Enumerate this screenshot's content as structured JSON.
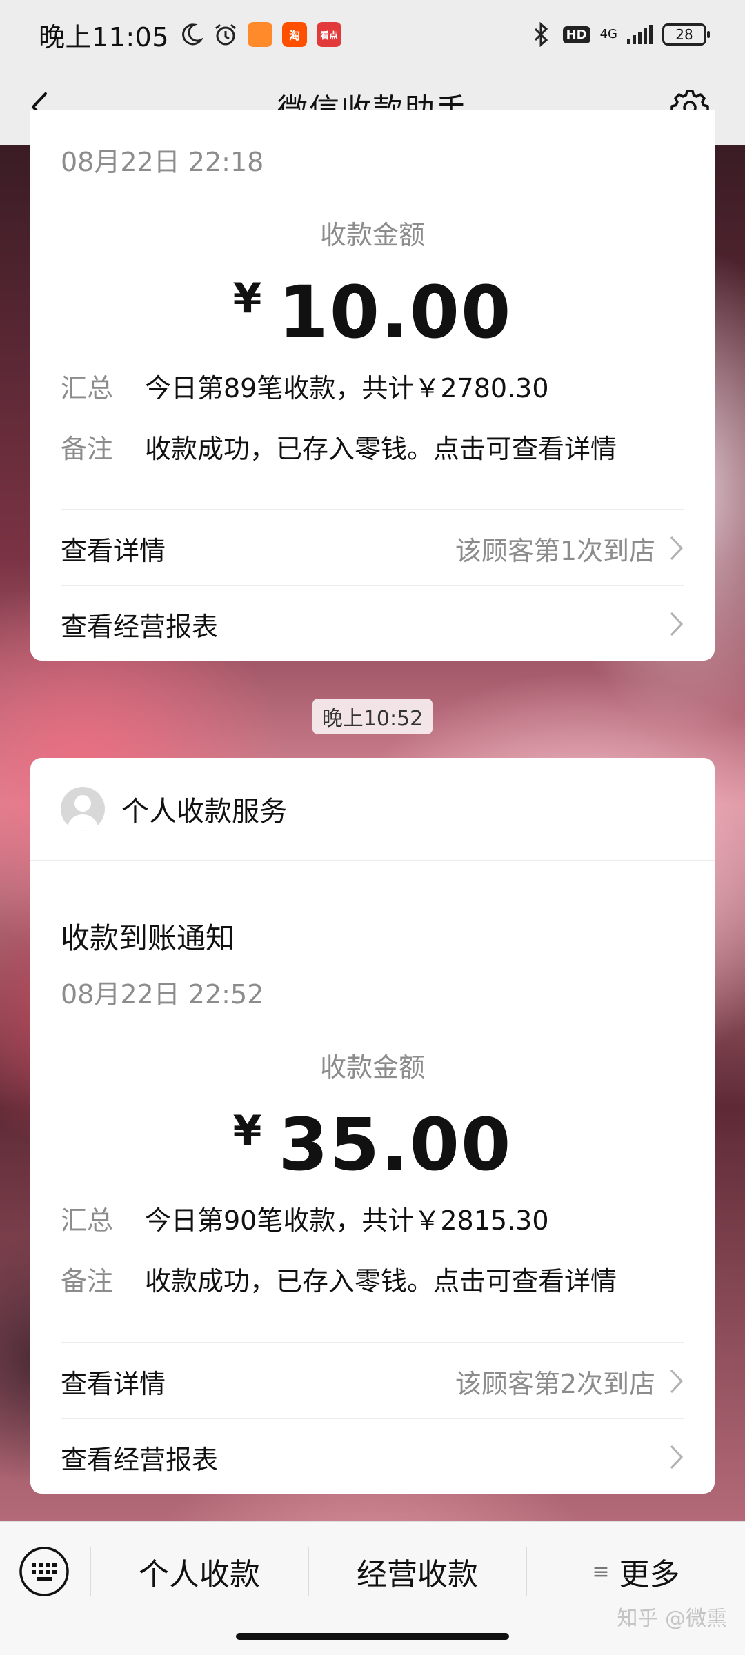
{
  "status_bar": {
    "time": "晚上11:05",
    "app_badges": [
      {
        "text": "",
        "color": "#ff8a2a"
      },
      {
        "text": "淘",
        "color": "#ff5000"
      },
      {
        "text": "看点",
        "color": "#e23a3a"
      }
    ],
    "network": "4G",
    "battery": "28"
  },
  "header": {
    "title": "微信收款助手"
  },
  "messages": [
    {
      "date": "08月22日 22:18",
      "amount_label": "收款金额",
      "currency": "¥",
      "amount": "10.00",
      "summary_key": "汇总",
      "summary_value": "今日第89笔收款，共计￥2780.30",
      "remark_key": "备注",
      "remark_value": "收款成功，已存入零钱。点击可查看详情",
      "details_label": "查看详情",
      "details_note": "该顾客第1次到店",
      "report_label": "查看经营报表"
    },
    {
      "time_chip": "晚上10:52",
      "service_name": "个人收款服务",
      "notice_title": "收款到账通知",
      "date": "08月22日 22:52",
      "amount_label": "收款金额",
      "currency": "¥",
      "amount": "35.00",
      "summary_key": "汇总",
      "summary_value": "今日第90笔收款，共计￥2815.30",
      "remark_key": "备注",
      "remark_value": "收款成功，已存入零钱。点击可查看详情",
      "details_label": "查看详情",
      "details_note": "该顾客第2次到店",
      "report_label": "查看经营报表"
    }
  ],
  "bottom_menu": {
    "items": [
      "个人收款",
      "经营收款",
      "更多"
    ],
    "more_icon": "≡"
  },
  "watermark": "知乎 @微熏",
  "colors": {
    "bar_bg": "#ededed",
    "card_bg": "#ffffff",
    "muted_text": "#8c8c8c"
  }
}
